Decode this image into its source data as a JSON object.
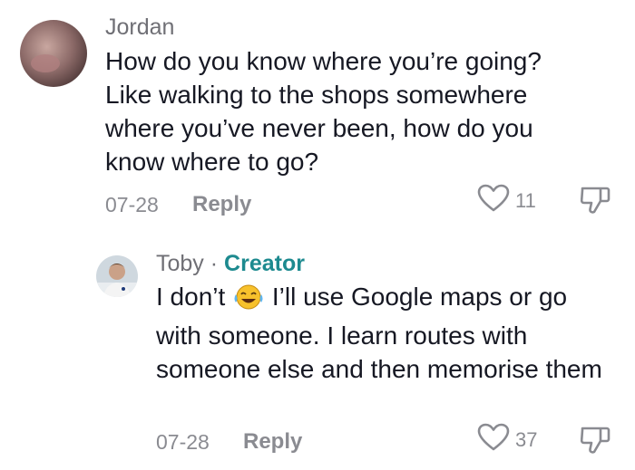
{
  "comments": [
    {
      "username": "Jordan",
      "text": "How do you know where you’re going? Like walking to the shops somewhere where you’ve never been, how do you know where to go?",
      "date": "07-28",
      "reply_label": "Reply",
      "likes": "11"
    },
    {
      "username": "Toby",
      "separator": " · ",
      "badge": "Creator",
      "text_before_emoji": "I don’t ",
      "emoji": "face-with-tears-of-joy",
      "text_after_emoji": " I’ll use Google maps or go with someone. I learn routes with someone else and then memorise them",
      "date": "07-28",
      "reply_label": "Reply",
      "likes": "37"
    }
  ],
  "icons": {
    "like": "heart-outline-icon",
    "dislike": "thumbs-down-outline-icon"
  },
  "colors": {
    "text": "#161823",
    "muted": "#8a8b91",
    "creator": "#1d8a8f"
  }
}
